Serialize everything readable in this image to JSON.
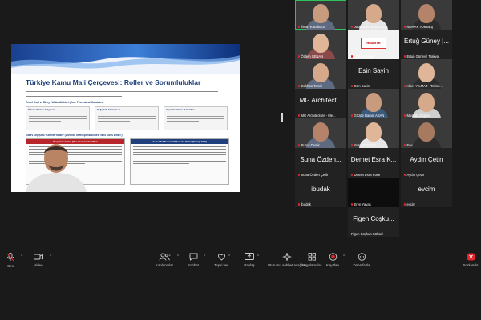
{
  "slide": {
    "title": "Türkiye Kamu Mali Çerçevesi: Roller ve Sorumluluklar",
    "section1": "Temel Usul ve Birey Yükümlülükleri (Core Procedural Mandates)",
    "box1": "Ödeme Dilekçe Belgeleri",
    "box2": "Bağışıklık Sözleşmesi",
    "box3": "Hayat Sabitleme & Gerilimi",
    "section2": "Görev Değişimi: Kim Ne Yapar? (Division of Responsibilities: Who Does What?)",
    "panel1": "Proje Yöneticileri (PI) / Harcama Yetkilileri",
    "panel2": "Ar-Ge/Mali Kurum / Muhasebe Birimi (Strateji SGB)"
  },
  "gallery": [
    {
      "name": "İhsan Karabulut",
      "kind": "video",
      "muted": true,
      "active": true
    },
    {
      "name": "05001934 DL4LOGLE",
      "kind": "video",
      "muted": true
    },
    {
      "name": "NURAY TOMBEŞ",
      "kind": "video",
      "muted": true
    },
    {
      "name": "Özlem SENAN",
      "kind": "video",
      "muted": true
    },
    {
      "name": "Volkan Öztürk",
      "kind": "logo",
      "logo": "HatAirTR",
      "muted": true
    },
    {
      "name": "Ertuğ Güney | Trakya",
      "big": "Ertuğ Güney |...",
      "kind": "text",
      "muted": true
    },
    {
      "name": "Gokhan Temiz",
      "kind": "video",
      "muted": true
    },
    {
      "name": "Esin Sayin",
      "big": "Esin Sayin",
      "kind": "text",
      "muted": true
    },
    {
      "name": "Alper YILMAZ - Tekird...",
      "kind": "video",
      "muted": true
    },
    {
      "name": "MG Architecture - Me...",
      "big": "MG Architect...",
      "kind": "text",
      "muted": true
    },
    {
      "name": "Gözde Damla ASAN",
      "kind": "video",
      "muted": true
    },
    {
      "name": "Mustafa Doğan",
      "kind": "video",
      "muted": true
    },
    {
      "name": "Burcu Demir",
      "kind": "video",
      "muted": true
    },
    {
      "name": "Yusuf Emrihatlı",
      "kind": "video",
      "muted": true
    },
    {
      "name": "Ece",
      "kind": "video",
      "muted": true
    },
    {
      "name": "Suna Özden Çelik",
      "big": "Suna Özden...",
      "kind": "text",
      "muted": true
    },
    {
      "name": "Demet Esra Kose",
      "big": "Demet Esra K...",
      "kind": "text",
      "muted": true
    },
    {
      "name": "Aydın Çetin",
      "big": "Aydın Çetin",
      "kind": "text",
      "muted": true
    },
    {
      "name": "ibudak",
      "big": "ibudak",
      "kind": "text",
      "muted": true
    },
    {
      "name": "Eren Yavaş",
      "kind": "dark",
      "muted": true
    },
    {
      "name": "evcim",
      "big": "evcim",
      "kind": "text",
      "muted": true
    },
    {
      "name": "Figen Coşkun Köksal",
      "big": "Figen Coşku...",
      "kind": "text",
      "muted": false
    }
  ],
  "toolbar": {
    "audio": "Ses",
    "video": "Video",
    "participants": "Katılımcılar",
    "participants_count": "23",
    "chat": "Sohbet",
    "react": "Tepki ver",
    "share": "Paylaş",
    "ai": "Oturumu sohbet asağları",
    "apps": "Uygulamalar",
    "record": "Kayıtları",
    "more": "Daha fazla",
    "end": "Sonlandır"
  },
  "colors": {
    "active_border": "#2ec25a",
    "mic_muted": "#e0242c",
    "slide_title": "#1d3e7a",
    "panel_red": "#b8262b",
    "panel_blue": "#1f3f7d"
  }
}
